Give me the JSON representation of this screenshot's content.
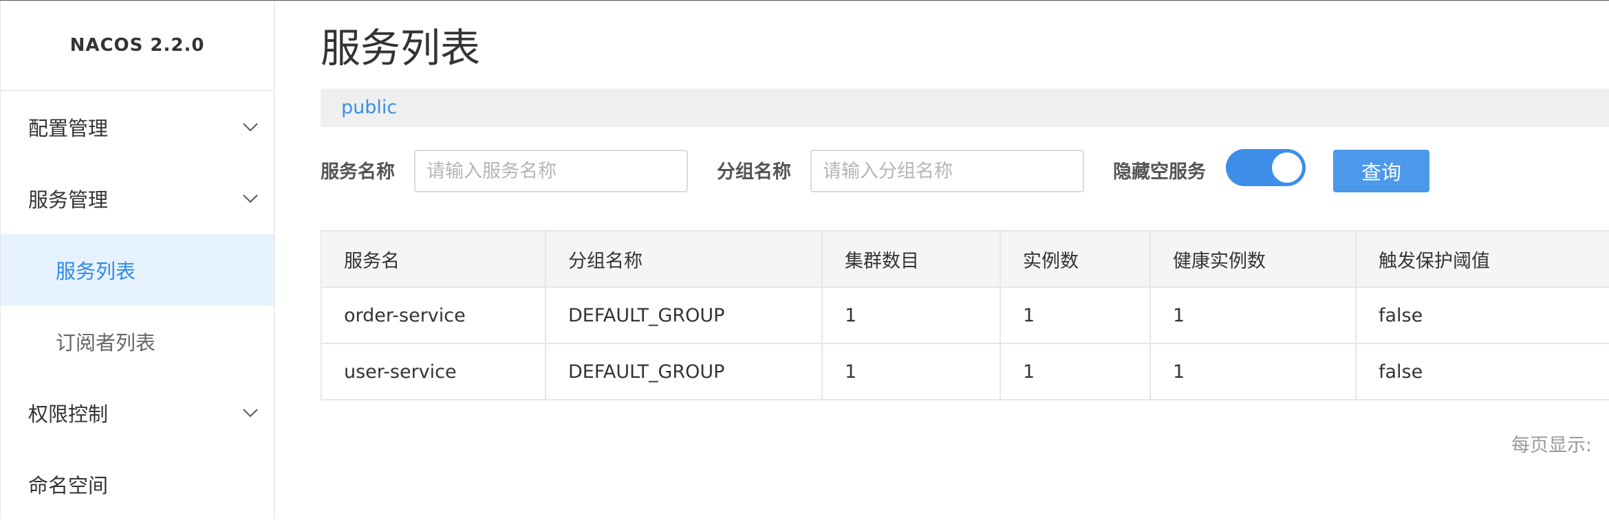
{
  "brand": "NACOS 2.2.0",
  "sidebar": {
    "items": [
      {
        "label": "配置管理"
      },
      {
        "label": "服务管理"
      },
      {
        "label": "服务列表"
      },
      {
        "label": "订阅者列表"
      },
      {
        "label": "权限控制"
      },
      {
        "label": "命名空间"
      }
    ]
  },
  "page": {
    "title": "服务列表",
    "namespace": "public"
  },
  "filters": {
    "service_name_label": "服务名称",
    "service_name_placeholder": "请输入服务名称",
    "group_name_label": "分组名称",
    "group_name_placeholder": "请输入分组名称",
    "hide_empty_label": "隐藏空服务",
    "hide_empty_on": true,
    "query_label": "查询"
  },
  "table": {
    "columns": [
      "服务名",
      "分组名称",
      "集群数目",
      "实例数",
      "健康实例数",
      "触发保护阈值"
    ],
    "rows": [
      [
        "order-service",
        "DEFAULT_GROUP",
        "1",
        "1",
        "1",
        "false"
      ],
      [
        "user-service",
        "DEFAULT_GROUP",
        "1",
        "1",
        "1",
        "false"
      ]
    ]
  },
  "pagination": {
    "per_page_label": "每页显示:"
  },
  "colors": {
    "accent": "#3d8ee8",
    "active_bg": "#e6f2fd"
  }
}
